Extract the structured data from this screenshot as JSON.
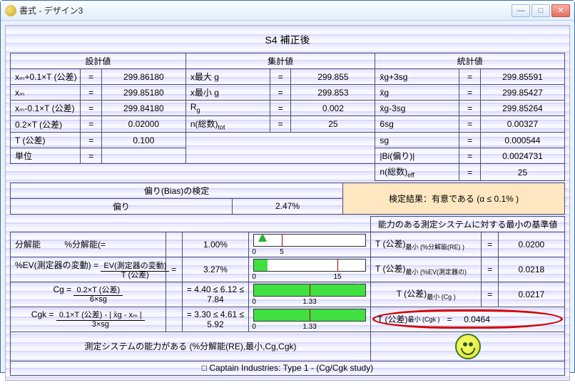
{
  "window": {
    "title": "書式 - デザイン3"
  },
  "header": {
    "title": "S4 補正後"
  },
  "colheads": {
    "design": "設計値",
    "collect": "集計値",
    "stat": "統計値"
  },
  "design": {
    "r1l": "xₘ+0.1×T (公差)",
    "r1v": "299.86180",
    "r2l": "xₘ",
    "r2v": "299.85180",
    "r3l": "xₘ-0.1×T (公差)",
    "r3v": "299.84180",
    "r4l": "0.2×T (公差)",
    "r4v": "0.02000",
    "r5l": "T (公差)",
    "r5v": "0.100",
    "r6l": "単位",
    "r6v": ""
  },
  "collect": {
    "r1l": "x最大 g",
    "r1v": "299.855",
    "r2l": "x最小 g",
    "r2v": "299.853",
    "r3l": "R",
    "r3s": "g",
    "r3v": "0.002",
    "r4l": "n(総数)",
    "r4s": "tot",
    "r4v": "25"
  },
  "stat": {
    "r1l": "x̄g+3sg",
    "r1v": "299.85591",
    "r2l": "x̄g",
    "r2v": "299.85427",
    "r3l": "x̄g-3sg",
    "r3v": "299.85264",
    "r4l": "6sg",
    "r4v": "0.00327",
    "r5l": "sg",
    "r5v": "0.000544",
    "r6l": "|Bi(偏り)|",
    "r6v": "0.0024731",
    "r7l": "n(総数)",
    "r7s": "eff",
    "r7v": "25"
  },
  "bias": {
    "section": "偏り(Bias)の検定",
    "label": "偏り",
    "value": "2.47%",
    "result": "検定結果：有意である (α ≤ 0.1% )"
  },
  "caps": {
    "header_right": "能力のある測定システムに対する最小の基準値",
    "row1": {
      "left": "分解能",
      "mid_l": "%分解能(=",
      "mid_v": "1.00%",
      "right_l_pre": "T (公差)",
      "right_l_sub": "最小 (%分解能(RE) )",
      "right_v": "0.0200"
    },
    "row2": {
      "left_pre": "%EV(測定器の変動) =",
      "num": "EV(測定器の変動)",
      "den": "T (公差)",
      "mid_v": "3.27%",
      "right_l_pre": "T (公差)",
      "right_l_sub": "最小 (%EV(測定器の)",
      "right_v": "0.0218"
    },
    "row3": {
      "left_pre": "Cg =",
      "num": "0.2×T (公差)",
      "den": "6×sg",
      "mid_v": "= 4.40 ≤ 6.12 ≤ 7.84",
      "right_l_pre": "T (公差)",
      "right_l_sub": "最小 (Cg )",
      "right_v": "0.0217"
    },
    "row4": {
      "left_pre": "Cgk =",
      "num": "0.1×T (公差) - | x̄g - xₘ |",
      "den": "3×sg",
      "mid_v": "= 3.30 ≤ 4.61 ≤ 5.92",
      "right_l_pre": "T (公差)",
      "right_l_sub": "最小 (Cgk )",
      "right_v": "0.0464"
    }
  },
  "gauges": {
    "g1": {
      "fill_pct": 5,
      "tick_pct": 25,
      "lab0": "0",
      "lab1": "5"
    },
    "g2": {
      "fill_pct": 12,
      "tick_pct": 75,
      "lab0": "0",
      "lab1": "15"
    },
    "g3": {
      "full": true,
      "tick_pct": 50,
      "lab0": "0",
      "lab1": "1.33"
    },
    "g4": {
      "full": true,
      "tick_pct": 50,
      "lab0": "0",
      "lab1": "1.33"
    }
  },
  "footer1": "測定システムの能力がある (%分解能(RE),最小,Cg,Cgk)",
  "footer2": "□ Captain Industries: Type 1 - (Cg/Cgk study)",
  "eq": "="
}
